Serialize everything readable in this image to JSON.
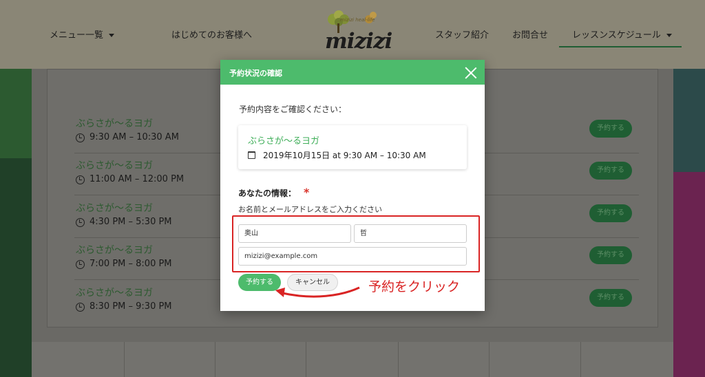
{
  "header": {
    "nav": [
      {
        "label": "メニュー一覧"
      },
      {
        "label": "はじめてのお客様へ"
      },
      {
        "label": "スタッフ紹介"
      },
      {
        "label": "お問合せ"
      },
      {
        "label": "レッスンスケジュール"
      }
    ],
    "logo": {
      "text": "mizizi",
      "subtext": "mizizi heal-life"
    }
  },
  "lessons": [
    {
      "name": "ぶらさが〜るヨガ",
      "time": "9:30 AM – 10:30 AM",
      "button": "予約する"
    },
    {
      "name": "ぶらさが〜るヨガ",
      "time": "11:00 AM – 12:00 PM",
      "button": "予約する"
    },
    {
      "name": "ぶらさが〜るヨガ",
      "time": "4:30 PM – 5:30 PM",
      "button": "予約する"
    },
    {
      "name": "ぶらさが〜るヨガ",
      "time": "7:00 PM – 8:00 PM",
      "button": "予約する"
    },
    {
      "name": "ぶらさが〜るヨガ",
      "time": "8:30 PM – 9:30 PM",
      "button": "予約する"
    }
  ],
  "modal": {
    "title": "予約状況の確認",
    "confirm_text": "予約内容をご確認ください：",
    "summary": {
      "name": "ぶらさが〜るヨガ",
      "date": "2019年10月15日 at 9:30 AM – 10:30 AM"
    },
    "info_label": "あなたの情報：",
    "required_mark": "*",
    "info_sub": "お名前とメールアドレスをご入力ください",
    "fields": {
      "last_name": "奥山",
      "first_name": "哲",
      "email": "mizizi@example.com"
    },
    "buttons": {
      "reserve": "予約する",
      "cancel": "キャンセル"
    }
  },
  "annotation": {
    "text": "予約をクリック",
    "color": "#d92424"
  },
  "colors": {
    "accent": "#4dbb6c",
    "annotation": "#d92424"
  }
}
